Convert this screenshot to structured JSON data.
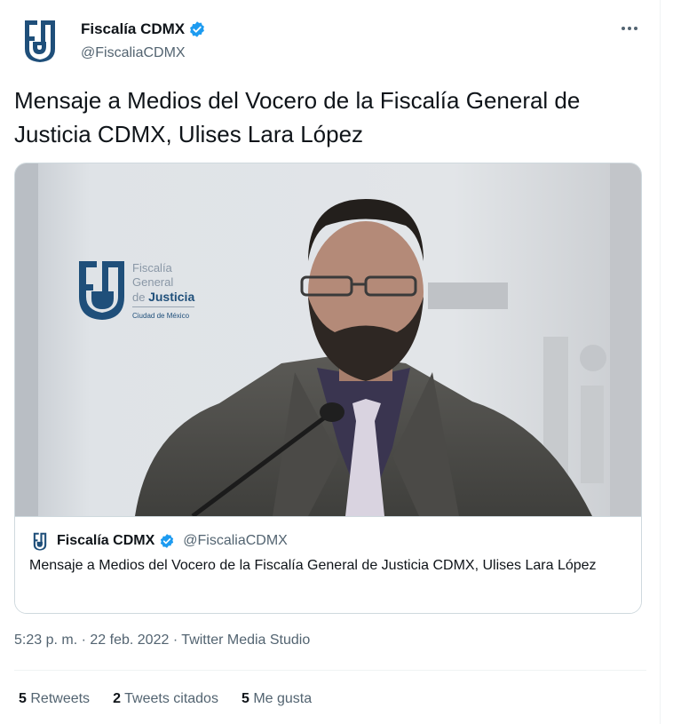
{
  "author": {
    "display_name": "Fiscalía CDMX",
    "handle": "@FiscaliaCDMX",
    "verified_icon": "verified-badge-icon",
    "more_icon": "more-options-icon"
  },
  "tweet_text": "Mensaje a Medios del Vocero de la Fiscalía General de Justicia CDMX, Ulises Lara López",
  "media": {
    "backdrop_brand": {
      "line1": "Fiscalía",
      "line2": "General",
      "line3_prefix": "de",
      "line3_emphasis": "Justicia",
      "line4": "Ciudad de México"
    }
  },
  "quoted": {
    "display_name": "Fiscalía CDMX",
    "handle": "@FiscaliaCDMX",
    "text": "Mensaje a Medios del Vocero de la Fiscalía General de Justicia CDMX, Ulises Lara López"
  },
  "meta": {
    "time": "5:23 p. m.",
    "separator": "·",
    "date": "22 feb. 2022",
    "source": "Twitter Media Studio"
  },
  "stats": {
    "retweets_count": "5",
    "retweets_label": "Retweets",
    "quotes_count": "2",
    "quotes_label": "Tweets citados",
    "likes_count": "5",
    "likes_label": "Me gusta"
  },
  "colors": {
    "brand_navy": "#1f4f7a",
    "verified_blue": "#1d9bf0",
    "secondary_text": "#536471"
  }
}
